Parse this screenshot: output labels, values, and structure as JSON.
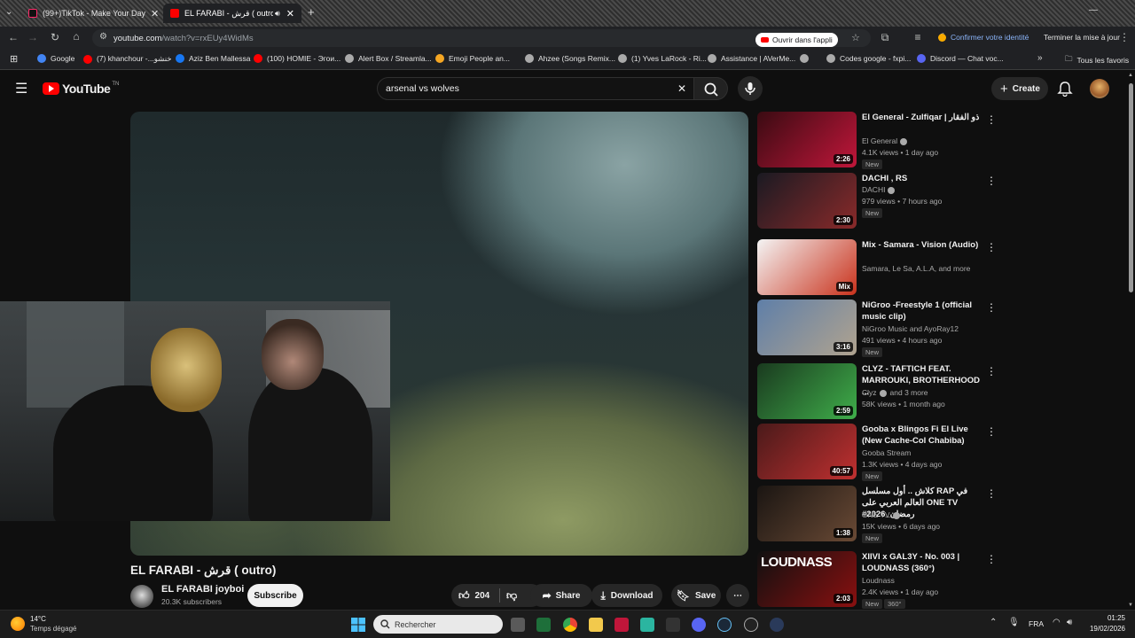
{
  "browser": {
    "tabs": [
      {
        "label": "(99+)TikTok - Make Your Day",
        "active": false
      },
      {
        "label": "EL FARABI - قرش ( outro) -",
        "active": true
      }
    ],
    "url_host": "youtube.com",
    "url_path": "/watch?v=rxEUy4WidMs",
    "open_in_app": "Ouvrir dans l'appli",
    "confirm_identity": "Confirmer votre identité",
    "finish_update": "Terminer la mise à jour",
    "bookmarks": [
      {
        "label": "Google",
        "color": "#4285f4"
      },
      {
        "label": "(7) khanchour -...خنشو",
        "color": "#ff0000"
      },
      {
        "label": "Aziz Ben Mallessa",
        "color": "#1877f2"
      },
      {
        "label": "(100) HOMIE - Эгои...",
        "color": "#ff0000"
      },
      {
        "label": "Alert Box / Streamla...",
        "color": "#aaaaaa"
      },
      {
        "label": "Emoji People an...",
        "color": "#f5a623"
      },
      {
        "label": "Ahzee (Songs Remix...",
        "color": "#aaaaaa"
      },
      {
        "label": "(1) Yves LaRock - Ri...",
        "color": "#aaaaaa"
      },
      {
        "label": "Assistance | AVerMe...",
        "color": "#aaaaaa"
      },
      {
        "label": "",
        "color": "#aaaaaa"
      },
      {
        "label": "Codes google - fxpi...",
        "color": "#aaaaaa"
      },
      {
        "label": "Discord — Chat voc...",
        "color": "#5865f2"
      }
    ],
    "all_favorites": "Tous les favoris"
  },
  "youtube": {
    "logo": "YouTube",
    "logo_sup": "TN",
    "search_value": "arsenal vs wolves",
    "create_label": "Create"
  },
  "video": {
    "title": "EL FARABI - قرش ( outro)",
    "channel": "EL FARABI joyboi",
    "subscribers": "20.3K subscribers",
    "subscribe_label": "Subscribe",
    "likes": "204",
    "share_label": "Share",
    "download_label": "Download",
    "save_label": "Save"
  },
  "recommendations": [
    {
      "title": "El General - Zulfiqar | ذو الفقار",
      "channel": "El General",
      "verified": true,
      "meta": "4.1K views • 1 day ago",
      "badge": "New",
      "duration": "2:26",
      "colors": [
        "#3a0b12",
        "#c0163a"
      ]
    },
    {
      "title": "DACHI , RS",
      "channel": "DACHI",
      "verified": true,
      "meta": "979 views • 7 hours ago",
      "badge": "New",
      "duration": "2:30",
      "colors": [
        "#1a1a22",
        "#8a2a2a"
      ]
    },
    {
      "title": "Mix - Samara - Vision (Audio)",
      "channel": "Samara, Le Sa, A.L.A, and more",
      "verified": false,
      "meta": "",
      "badge": "",
      "duration": "Mix",
      "colors": [
        "#f4f4f4",
        "#c9321c"
      ]
    },
    {
      "title": "NiGroo -Freestyle 1 (official music clip)",
      "channel": "NiGroo Music and AyoRay12",
      "verified": false,
      "meta": "491 views • 4 hours ago",
      "badge": "New",
      "duration": "3:16",
      "colors": [
        "#5f7fa8",
        "#b0a38f"
      ]
    },
    {
      "title": "CLYZ - TAFTICH FEAT. MARROUKI, BROTHERHOOD ...",
      "channel": "Clyz",
      "verified": true,
      "channel_suffix": "and 3 more",
      "meta": "58K views • 1 month ago",
      "badge": "",
      "duration": "2:59",
      "colors": [
        "#1a3a1f",
        "#3fae4a"
      ]
    },
    {
      "title": "Gooba x Blingos Fi El Live (New Cache-Col Chabiba)",
      "channel": "Gooba Stream",
      "verified": false,
      "meta": "1.3K views • 4 days ago",
      "badge": "New",
      "duration": "40:57",
      "colors": [
        "#4a1a1a",
        "#c03030"
      ]
    },
    {
      "title": "كلاش .. أول مسلسل RAP في العالم العربي على ONE TV #رمضان_2026",
      "channel": "ONE TV",
      "verified": true,
      "meta": "15K views • 6 days ago",
      "badge": "New",
      "duration": "1:38",
      "colors": [
        "#1a1512",
        "#6a4a35"
      ]
    },
    {
      "title": "XIIVI x GAL3Y - No. 003 | LOUDNASS (360°)",
      "channel": "Loudnass",
      "verified": false,
      "meta": "2.4K views • 1 day ago",
      "badge": "New",
      "badge2": "360°",
      "duration": "2:03",
      "thumb_text": "LOUDNASS",
      "colors": [
        "#101010",
        "#8a1010"
      ]
    }
  ],
  "taskbar": {
    "temperature": "14°C",
    "weather": "Temps dégagé",
    "search_placeholder": "Rechercher",
    "language": "FRA",
    "time": "01:25",
    "date": "19/02/2026"
  }
}
